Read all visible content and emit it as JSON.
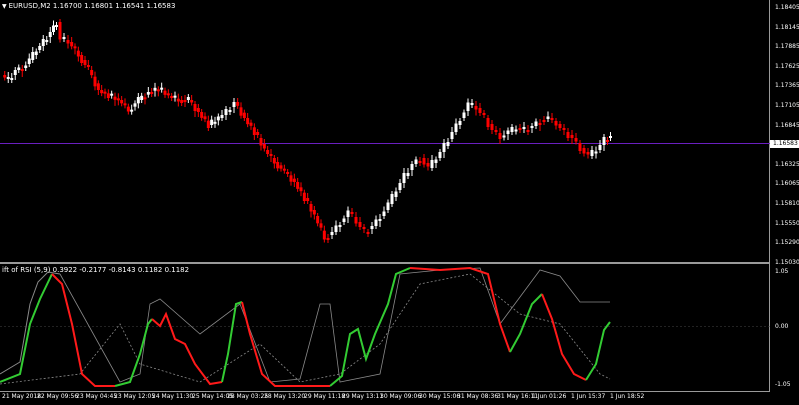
{
  "main_chart": {
    "header": "EURUSD,M2  1.16700 1.16801 1.16541 1.16583",
    "price_labels": [
      "1.18405",
      "1.18145",
      "1.17885",
      "1.17625",
      "1.17365",
      "1.17105",
      "1.16845",
      "1.16583",
      "1.16325",
      "1.16065",
      "1.15810",
      "1.15550",
      "1.15290",
      "1.15030"
    ],
    "current_price": "1.16583",
    "colors": {
      "bull": "#ffffff",
      "bear": "#ff0000",
      "price_line": "#6a1fbf"
    }
  },
  "indicator": {
    "header": "ift of RSI (5,9) 0.3922 -0.2177 -0.8143 0.1182 0.1182",
    "levels": [
      "1.05",
      "0.00",
      "-1.05"
    ],
    "colors": {
      "up": "#33cc33",
      "down": "#ff1a1a",
      "grey": "#8a8a8a"
    }
  },
  "time_axis": [
    "21 May 2018",
    "22 May 09:56",
    "23 May 04:45",
    "23 May 12:05",
    "24 May 11:30",
    "25 May 14:05",
    "28 May 03:25",
    "28 May 13:20",
    "29 May 11:18",
    "29 May 13:11",
    "30 May 09:06",
    "30 May 15:06",
    "31 May 08:36",
    "31 May 16:11",
    "1 Jun 01:26",
    "1 Jun 15:37",
    "1 Jun 18:52"
  ]
}
